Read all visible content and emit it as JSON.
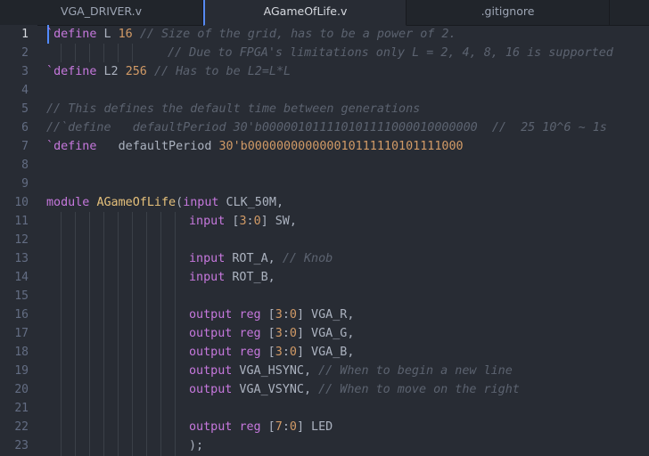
{
  "tabs": [
    {
      "label": "VGA_DRIVER.v",
      "active": false
    },
    {
      "label": "AGameOfLife.v",
      "active": true
    },
    {
      "label": ".gitignore",
      "active": false
    },
    {
      "label": "",
      "active": false
    }
  ],
  "gutter": {
    "line_numbers": [
      "1",
      "2",
      "3",
      "4",
      "5",
      "6",
      "7",
      "8",
      "9",
      "10",
      "11",
      "12",
      "13",
      "14",
      "15",
      "16",
      "17",
      "18",
      "19",
      "20",
      "21",
      "22",
      "23"
    ],
    "current_line": "1"
  },
  "code": {
    "l1": {
      "tick": "`",
      "kw": "define",
      "sp1": " L ",
      "num": "16",
      "sp2": " ",
      "cm": "// Size of the grid, has to be a power of 2."
    },
    "l2": {
      "cm": "// Due to FPGA's limitations only L = 2, 4, 8, 16 is supported"
    },
    "l3": {
      "tick": "`",
      "kw": "define",
      "sp1": " L2 ",
      "num": "256",
      "sp2": " ",
      "cm": "// Has to be L2=L*L"
    },
    "l5": {
      "cm": "// This defines the default time between generations"
    },
    "l6": {
      "cm": "//`define   defaultPeriod 30'b000001011110101111000010000000  //  25 10^6 ~ 1s"
    },
    "l7": {
      "tick": "`",
      "kw": "define",
      "sp1": "   defaultPeriod ",
      "num": "30'b000000000000010111110101111000"
    },
    "l10": {
      "kw": "module",
      "sp1": " ",
      "fn": "AGameOfLife",
      "p1": "(",
      "kw2": "input",
      "rest": " CLK_50M,"
    },
    "l11": {
      "kw": "input",
      "p1": " [",
      "n1": "3",
      "p2": ":",
      "n2": "0",
      "rest": "] SW,"
    },
    "l13": {
      "kw": "input",
      "rest": " ROT_A, ",
      "cm": "// Knob"
    },
    "l14": {
      "kw": "input",
      "rest": " ROT_B,"
    },
    "l16": {
      "kw": "output",
      "sp": " ",
      "kw2": "reg",
      "p1": " [",
      "n1": "3",
      "p2": ":",
      "n2": "0",
      "rest": "] VGA_R,"
    },
    "l17": {
      "kw": "output",
      "sp": " ",
      "kw2": "reg",
      "p1": " [",
      "n1": "3",
      "p2": ":",
      "n2": "0",
      "rest": "] VGA_G,"
    },
    "l18": {
      "kw": "output",
      "sp": " ",
      "kw2": "reg",
      "p1": " [",
      "n1": "3",
      "p2": ":",
      "n2": "0",
      "rest": "] VGA_B,"
    },
    "l19": {
      "kw": "output",
      "rest": " VGA_HSYNC, ",
      "cm": "// When to begin a new line"
    },
    "l20": {
      "kw": "output",
      "rest": " VGA_VSYNC, ",
      "cm": "// When to move on the right"
    },
    "l22": {
      "kw": "output",
      "sp": " ",
      "kw2": "reg",
      "p1": " [",
      "n1": "7",
      "p2": ":",
      "n2": "0",
      "rest": "] LED"
    },
    "l23": {
      "rest": ");"
    }
  }
}
